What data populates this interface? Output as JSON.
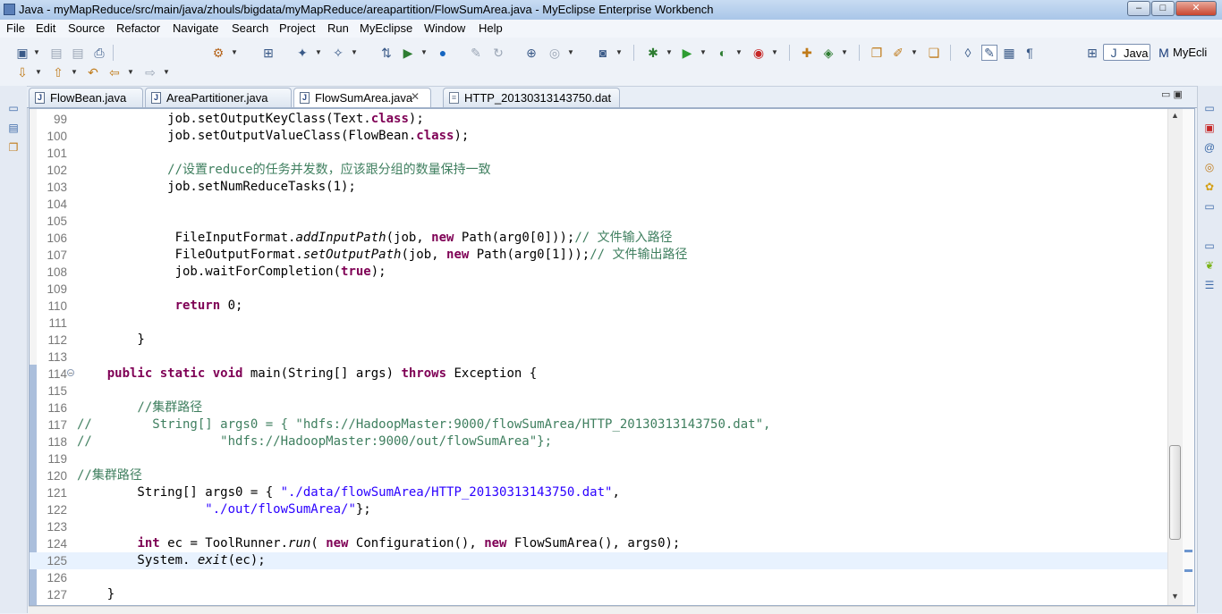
{
  "window": {
    "title": "Java - myMapReduce/src/main/java/zhouls/bigdata/myMapReduce/areapartition/FlowSumArea.java - MyEclipse Enterprise Workbench",
    "controls": [
      "–",
      "□",
      "✕"
    ]
  },
  "menu": [
    "File",
    "Edit",
    "Source",
    "Refactor",
    "Navigate",
    "Search",
    "Project",
    "Run",
    "MyEclipse",
    "Window",
    "Help"
  ],
  "perspectives": {
    "active": "Java",
    "other": "MyEcli"
  },
  "tabs": [
    {
      "label": "FlowBean.java",
      "active": false,
      "closable": false
    },
    {
      "label": "AreaPartitioner.java",
      "active": false,
      "closable": false
    },
    {
      "label": "FlowSumArea.java",
      "active": true,
      "closable": true
    },
    {
      "label": "HTTP_20130313143750.dat",
      "active": false,
      "closable": false
    }
  ],
  "editor": {
    "current_line": 125,
    "fold_marker_line": 114,
    "lines": [
      {
        "n": "99",
        "t": [
          [
            "",
            "            job.setOutputKeyClass(Text."
          ],
          [
            "kw",
            "class"
          ],
          [
            "",
            ");"
          ]
        ]
      },
      {
        "n": "100",
        "t": [
          [
            "",
            "            job.setOutputValueClass(FlowBean."
          ],
          [
            "kw",
            "class"
          ],
          [
            "",
            ");"
          ]
        ]
      },
      {
        "n": "101",
        "t": []
      },
      {
        "n": "102",
        "t": [
          [
            "cmt",
            "            //设置reduce的任务并发数，应该跟分组的数量保持一致"
          ]
        ]
      },
      {
        "n": "103",
        "t": [
          [
            "",
            "            job.setNumReduceTasks(1);"
          ]
        ]
      },
      {
        "n": "104",
        "t": []
      },
      {
        "n": "105",
        "t": []
      },
      {
        "n": "106",
        "t": [
          [
            "",
            "             FileInputFormat."
          ],
          [
            "it",
            "addInputPath"
          ],
          [
            "",
            "(job, "
          ],
          [
            "kw",
            "new"
          ],
          [
            "",
            " Path(arg0[0]));"
          ],
          [
            "cmt",
            "// 文件输入路径"
          ]
        ]
      },
      {
        "n": "107",
        "t": [
          [
            "",
            "             FileOutputFormat."
          ],
          [
            "it",
            "setOutputPath"
          ],
          [
            "",
            "(job, "
          ],
          [
            "kw",
            "new"
          ],
          [
            "",
            " Path(arg0[1]));"
          ],
          [
            "cmt",
            "// 文件输出路径"
          ]
        ]
      },
      {
        "n": "108",
        "t": [
          [
            "",
            "             job.waitForCompletion("
          ],
          [
            "kw",
            "true"
          ],
          [
            "",
            ");"
          ]
        ]
      },
      {
        "n": "109",
        "t": []
      },
      {
        "n": "110",
        "t": [
          [
            "",
            "             "
          ],
          [
            "kw",
            "return"
          ],
          [
            "",
            " 0;"
          ]
        ]
      },
      {
        "n": "111",
        "t": []
      },
      {
        "n": "112",
        "t": [
          [
            "",
            "        }"
          ]
        ]
      },
      {
        "n": "113",
        "t": []
      },
      {
        "n": "114",
        "t": [
          [
            "",
            "    "
          ],
          [
            "kw",
            "public static void"
          ],
          [
            "",
            " main(String[] args) "
          ],
          [
            "kw",
            "throws"
          ],
          [
            "",
            " Exception {"
          ]
        ]
      },
      {
        "n": "115",
        "t": []
      },
      {
        "n": "116",
        "t": [
          [
            "cmt",
            "        //集群路径"
          ]
        ]
      },
      {
        "n": "117",
        "t": [
          [
            "cmt",
            "//        String[] args0 = { \"hdfs://HadoopMaster:9000/flowSumArea/HTTP_20130313143750.dat\","
          ]
        ]
      },
      {
        "n": "118",
        "t": [
          [
            "cmt",
            "//                 \"hdfs://HadoopMaster:9000/out/flowSumArea\"};"
          ]
        ]
      },
      {
        "n": "119",
        "t": []
      },
      {
        "n": "120",
        "t": [
          [
            "cmt",
            "//集群路径"
          ]
        ]
      },
      {
        "n": "121",
        "t": [
          [
            "",
            "        String[] args0 = { "
          ],
          [
            "str",
            "\"./data/flowSumArea/HTTP_20130313143750.dat\""
          ],
          [
            "",
            ","
          ]
        ]
      },
      {
        "n": "122",
        "t": [
          [
            "",
            "                 "
          ],
          [
            "str",
            "\"./out/flowSumArea/\""
          ],
          [
            "",
            "};"
          ]
        ]
      },
      {
        "n": "123",
        "t": []
      },
      {
        "n": "124",
        "t": [
          [
            "",
            "        "
          ],
          [
            "kw",
            "int"
          ],
          [
            "",
            " ec = ToolRunner."
          ],
          [
            "it",
            "run"
          ],
          [
            "",
            "( "
          ],
          [
            "kw",
            "new"
          ],
          [
            "",
            " Configuration(), "
          ],
          [
            "kw",
            "new"
          ],
          [
            "",
            " FlowSumArea(), args0);"
          ]
        ]
      },
      {
        "n": "125",
        "t": [
          [
            "",
            "        System. "
          ],
          [
            "it",
            "exit"
          ],
          [
            "",
            "(ec);"
          ]
        ]
      },
      {
        "n": "126",
        "t": []
      },
      {
        "n": "127",
        "t": [
          [
            "",
            "    }"
          ]
        ]
      }
    ]
  }
}
